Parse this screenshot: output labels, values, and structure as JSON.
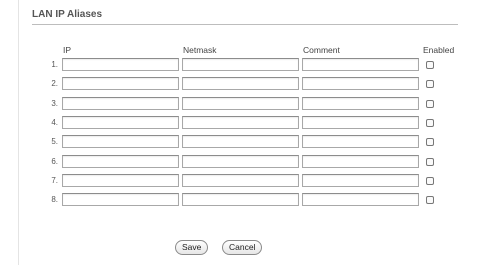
{
  "section": {
    "title": "LAN IP Aliases"
  },
  "columns": {
    "ip": "IP",
    "netmask": "Netmask",
    "comment": "Comment",
    "enabled": "Enabled"
  },
  "rows": [
    {
      "num": "1.",
      "ip": "",
      "netmask": "",
      "comment": "",
      "enabled": false
    },
    {
      "num": "2.",
      "ip": "",
      "netmask": "",
      "comment": "",
      "enabled": false
    },
    {
      "num": "3.",
      "ip": "",
      "netmask": "",
      "comment": "",
      "enabled": false
    },
    {
      "num": "4.",
      "ip": "",
      "netmask": "",
      "comment": "",
      "enabled": false
    },
    {
      "num": "5.",
      "ip": "",
      "netmask": "",
      "comment": "",
      "enabled": false
    },
    {
      "num": "6.",
      "ip": "",
      "netmask": "",
      "comment": "",
      "enabled": false
    },
    {
      "num": "7.",
      "ip": "",
      "netmask": "",
      "comment": "",
      "enabled": false
    },
    {
      "num": "8.",
      "ip": "",
      "netmask": "",
      "comment": "",
      "enabled": false
    }
  ],
  "buttons": {
    "save": "Save",
    "cancel": "Cancel"
  }
}
